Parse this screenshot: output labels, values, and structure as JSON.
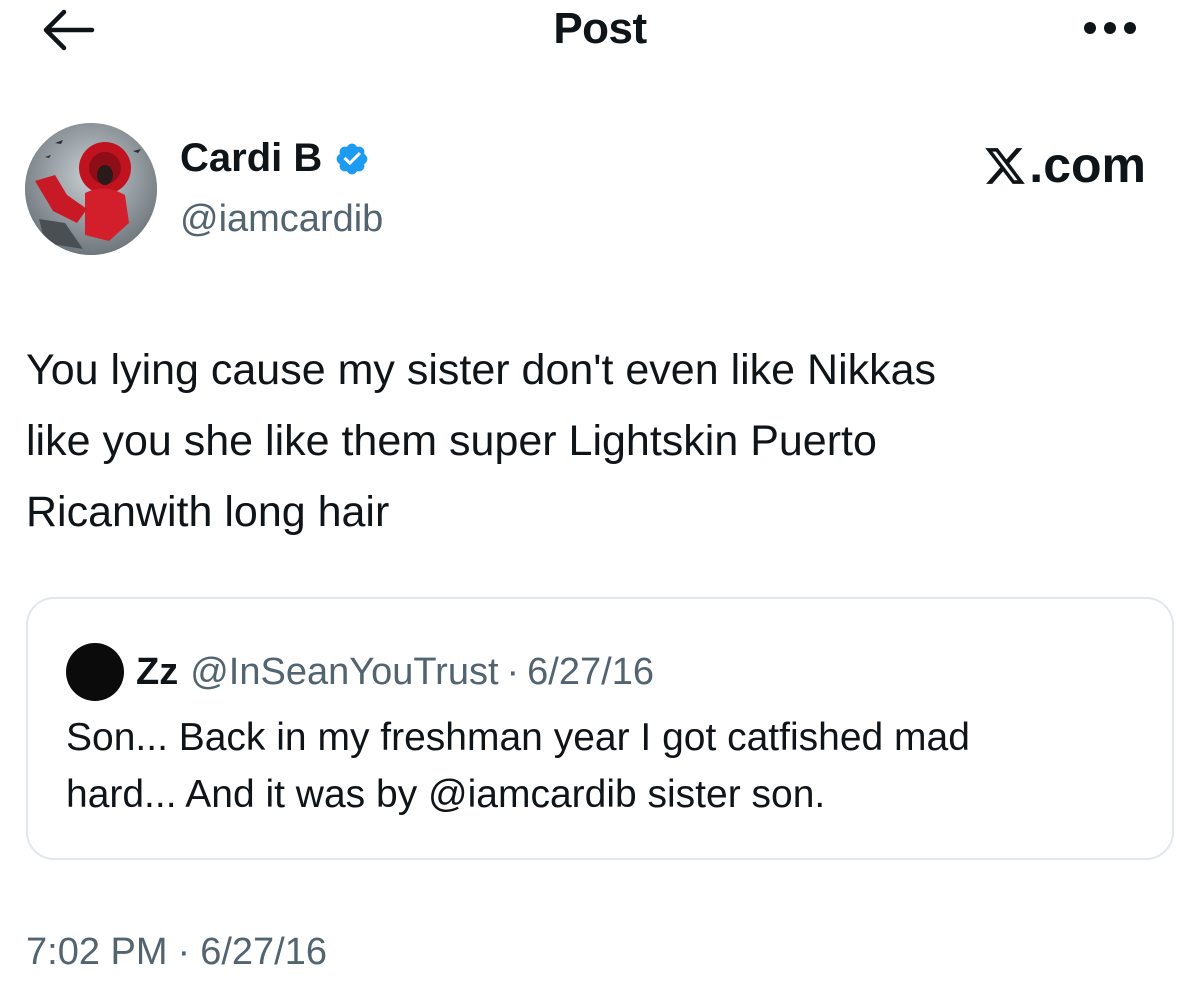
{
  "header": {
    "title": "Post",
    "back_icon": "arrow-left-icon",
    "more_icon": "more-horizontal-icon"
  },
  "author": {
    "name": "Cardi B",
    "handle": "@iamcardib",
    "verified_icon": "verified-badge-icon",
    "verified_color": "#1d9bf0"
  },
  "site": {
    "label": ".com",
    "logo_icon": "x-logo-icon"
  },
  "post": {
    "text_lines": [
      "You lying cause my sister don't even like Nikkas",
      "like you she like them super Lightskin Puerto",
      "Ricanwith long hair"
    ]
  },
  "quote": {
    "name": "Zz",
    "handle": "@InSeanYouTrust",
    "separator": "·",
    "date": "6/27/16",
    "text_lines": [
      "Son... Back in my freshman year I got catfished mad",
      "hard... And it was by @iamcardib sister son."
    ]
  },
  "timestamp": {
    "time": "7:02 PM",
    "separator": "·",
    "date": "6/27/16"
  },
  "colors": {
    "text": "#0f1419",
    "secondary": "#536471",
    "border": "#e1e8ed"
  }
}
